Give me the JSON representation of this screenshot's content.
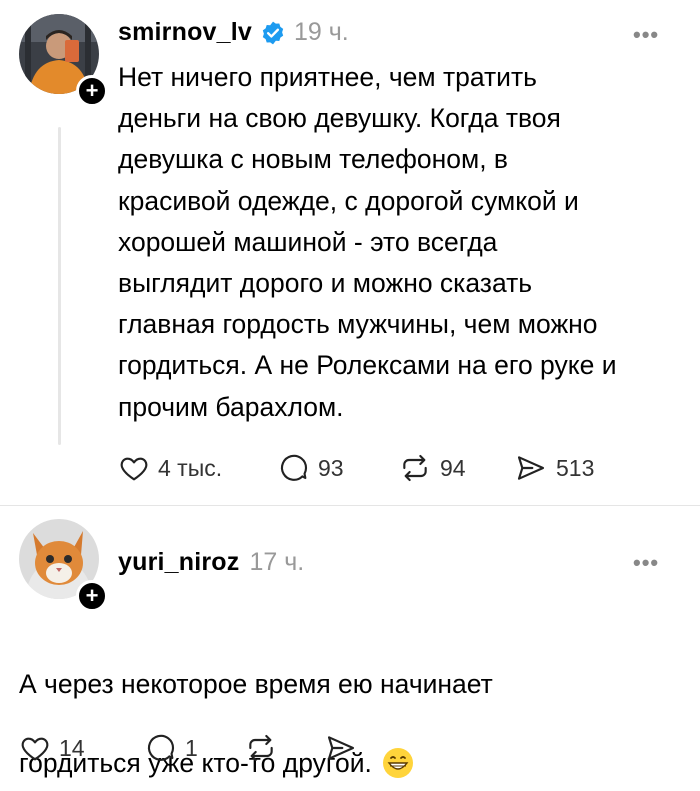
{
  "post": {
    "username": "smirnov_lv",
    "time": "19 ч.",
    "text": "Нет ничего приятнее, чем тратить\nденьги на свою девушку. Когда твоя\nдевушка с новым телефоном, в\nкрасивой одежде, с дорогой сумкой и\nхорошей машиной - это всегда\nвыглядит дорого и можно сказать\nглавная гордость мужчины, чем можно\nгордиться. А не Ролексами на его руке и\nпрочим барахлом.",
    "likes": "4 тыс.",
    "comments": "93",
    "reposts": "94",
    "shares": "513",
    "more_icon": "more-icon",
    "verified_icon": "verified-badge-icon"
  },
  "reply": {
    "username": "yuri_niroz",
    "time": "17 ч.",
    "text": "А через некоторое время ею начинает\nгордиться уже кто-то другой.",
    "emoji": "😁",
    "likes": "14",
    "comments": "1"
  },
  "colors": {
    "verified": "#1d9bf0",
    "muted": "#999999"
  }
}
